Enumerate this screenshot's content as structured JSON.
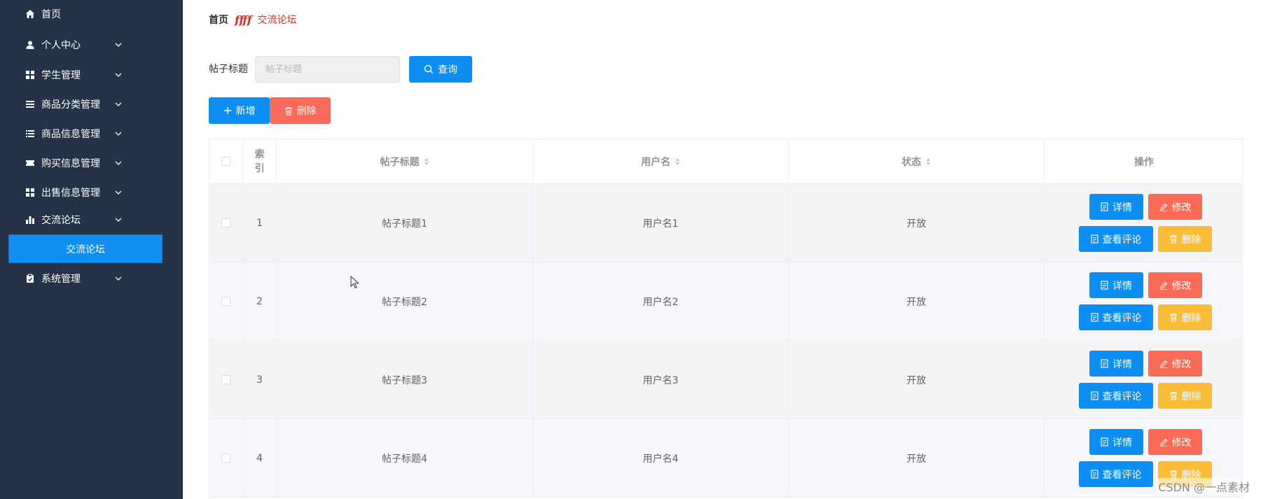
{
  "sidebar": {
    "items": [
      {
        "label": "首页",
        "icon": "home-icon",
        "has_children": false
      },
      {
        "label": "个人中心",
        "icon": "user-icon",
        "has_children": true
      },
      {
        "label": "学生管理",
        "icon": "grid-icon",
        "has_children": true
      },
      {
        "label": "商品分类管理",
        "icon": "list-icon",
        "has_children": true
      },
      {
        "label": "商品信息管理",
        "icon": "list-icon",
        "has_children": true
      },
      {
        "label": "购买信息管理",
        "icon": "ticket-icon",
        "has_children": true
      },
      {
        "label": "出售信息管理",
        "icon": "grid-icon",
        "has_children": true
      },
      {
        "label": "交流论坛",
        "icon": "bar-chart-icon",
        "has_children": true
      },
      {
        "label": "系统管理",
        "icon": "clipboard-icon",
        "has_children": true
      }
    ],
    "active_submenu": "交流论坛"
  },
  "breadcrumb": {
    "home": "首页",
    "current": "交流论坛"
  },
  "search": {
    "label": "帖子标题",
    "placeholder": "帖子标题",
    "value": "",
    "button": "查询"
  },
  "toolbar": {
    "add": "新增",
    "delete": "删除"
  },
  "table": {
    "headers": {
      "index": "索引",
      "title": "帖子标题",
      "username": "用户名",
      "status": "状态",
      "actions": "操作"
    },
    "rows": [
      {
        "index": "1",
        "title": "帖子标题1",
        "username": "用户名1",
        "status": "开放"
      },
      {
        "index": "2",
        "title": "帖子标题2",
        "username": "用户名2",
        "status": "开放"
      },
      {
        "index": "3",
        "title": "帖子标题3",
        "username": "用户名3",
        "status": "开放"
      },
      {
        "index": "4",
        "title": "帖子标题4",
        "username": "用户名4",
        "status": "开放"
      }
    ],
    "row_actions": {
      "detail": "详情",
      "edit": "修改",
      "comments": "查看评论",
      "delete": "删除"
    }
  },
  "watermark": "CSDN @一点素材",
  "colors": {
    "sidebar_bg": "#243347",
    "primary": "#0d8ef2",
    "danger": "#fa6a5a",
    "warning": "#fbbd35",
    "breadcrumb_accent": "#c0392b"
  }
}
